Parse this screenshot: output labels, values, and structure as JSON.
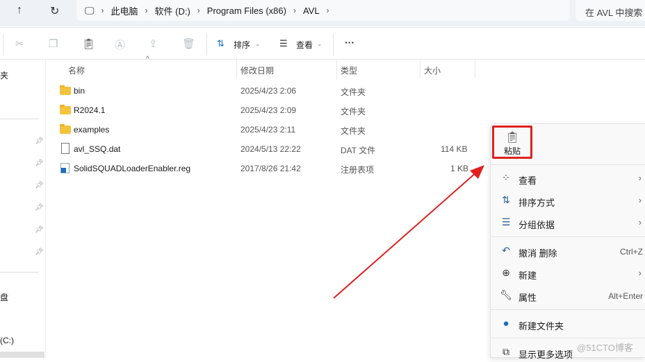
{
  "address": {
    "crumbs": [
      "此电脑",
      "软件 (D:)",
      "Program Files (x86)",
      "AVL"
    ],
    "search_placeholder": "在 AVL 中搜索"
  },
  "toolbar": {
    "sort": "排序",
    "view": "查看",
    "more": "···"
  },
  "sidebar": {
    "items": [
      "夹",
      "盘",
      "(C:)"
    ]
  },
  "columns": [
    "名称",
    "修改日期",
    "类型",
    "大小"
  ],
  "files": [
    {
      "name": "bin",
      "date": "2025/4/23 2:06",
      "type": "文件夹",
      "size": "",
      "icon": "folder"
    },
    {
      "name": "R2024.1",
      "date": "2025/4/23 2:09",
      "type": "文件夹",
      "size": "",
      "icon": "folder"
    },
    {
      "name": "examples",
      "date": "2025/4/23 2:11",
      "type": "文件夹",
      "size": "",
      "icon": "folder"
    },
    {
      "name": "avl_SSQ.dat",
      "date": "2024/5/13 22:22",
      "type": "DAT 文件",
      "size": "114 KB",
      "icon": "file"
    },
    {
      "name": "SolidSQUADLoaderEnabler.reg",
      "date": "2017/8/26 21:42",
      "type": "注册表项",
      "size": "1 KB",
      "icon": "reg"
    }
  ],
  "context_menu": {
    "paste": "粘贴",
    "items": [
      {
        "label": "查看",
        "shortcut": ""
      },
      {
        "label": "排序方式",
        "shortcut": ""
      },
      {
        "label": "分组依据",
        "shortcut": ""
      },
      {
        "label": "撤消 删除",
        "shortcut": "Ctrl+Z"
      },
      {
        "label": "新建",
        "shortcut": ""
      },
      {
        "label": "属性",
        "shortcut": "Alt+Enter"
      },
      {
        "label": "新建文件夹",
        "shortcut": ""
      },
      {
        "label": "显示更多选项",
        "shortcut": ""
      }
    ]
  },
  "watermark": "@51CTO博客",
  "colors": {
    "highlight": "#e02020",
    "accent": "#1a6fc0"
  }
}
